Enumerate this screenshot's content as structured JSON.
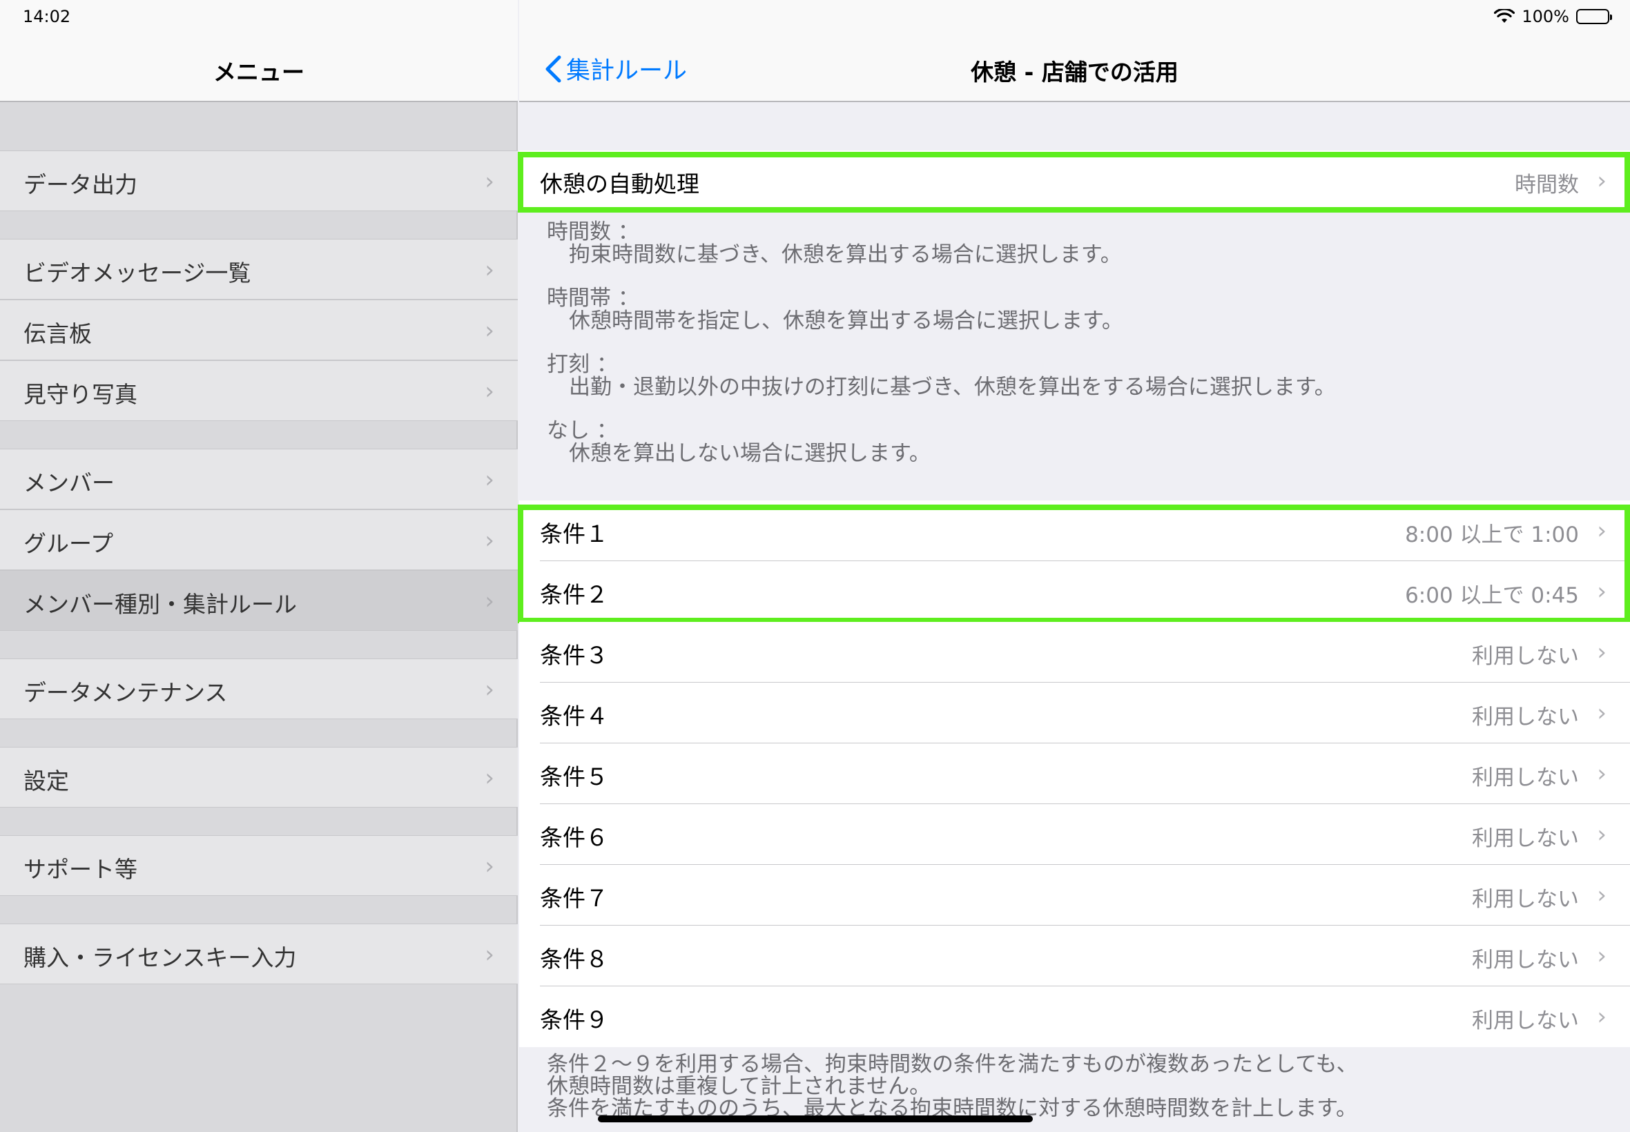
{
  "status": {
    "time": "14:02",
    "battery": "100%"
  },
  "left": {
    "title": "メニュー",
    "items": [
      {
        "label": "データ出力"
      },
      {
        "label": "ビデオメッセージ一覧"
      },
      {
        "label": "伝言板"
      },
      {
        "label": "見守り写真"
      },
      {
        "label": "メンバー"
      },
      {
        "label": "グループ"
      },
      {
        "label": "メンバー種別・集計ルール"
      },
      {
        "label": "データメンテナンス"
      },
      {
        "label": "設定"
      },
      {
        "label": "サポート等"
      },
      {
        "label": "購入・ライセンスキー入力"
      }
    ]
  },
  "right": {
    "back_label": "集計ルール",
    "title": "休憩 - 店舗での活用",
    "auto": {
      "label": "休憩の自動処理",
      "value": "時間数"
    },
    "descriptions": [
      {
        "heading": "時間数 ：",
        "body": "拘束時間数に基づき、休憩を算出する場合に選択します。"
      },
      {
        "heading": "時間帯 ：",
        "body": "休憩時間帯を指定し、休憩を算出する場合に選択します。"
      },
      {
        "heading": "打刻 ：",
        "body": "出勤・退勤以外の中抜けの打刻に基づき、休憩を算出をする場合に選択します。"
      },
      {
        "heading": "なし ：",
        "body": "休憩を算出しない場合に選択します。"
      }
    ],
    "conditions": [
      {
        "label": "条件１",
        "value": "8:00 以上で 1:00"
      },
      {
        "label": "条件２",
        "value": "6:00 以上で 0:45"
      },
      {
        "label": "条件３",
        "value": "利用しない"
      },
      {
        "label": "条件４",
        "value": "利用しない"
      },
      {
        "label": "条件５",
        "value": "利用しない"
      },
      {
        "label": "条件６",
        "value": "利用しない"
      },
      {
        "label": "条件７",
        "value": "利用しない"
      },
      {
        "label": "条件８",
        "value": "利用しない"
      },
      {
        "label": "条件９",
        "value": "利用しない"
      }
    ],
    "footer": [
      "条件２〜９を利用する場合、拘束時間数の条件を満たすものが複数あったとしても、",
      "休憩時間数は重複して計上されません。",
      "条件を満たすもののうち、最大となる拘束時間数に対する休憩時間数を計上します。"
    ]
  },
  "colors": {
    "accent": "#007aff",
    "highlight": "#5eee1e"
  }
}
